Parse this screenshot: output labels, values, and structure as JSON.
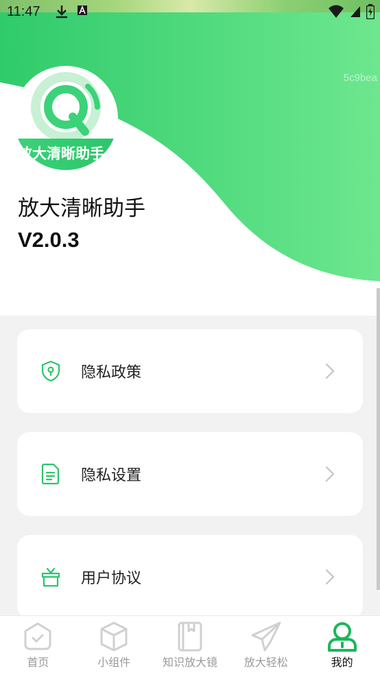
{
  "status_bar": {
    "time": "11:47",
    "left_icons": [
      "download-icon",
      "a-badge-icon"
    ],
    "right_icons": [
      "wifi-icon",
      "signal-icon",
      "battery-icon"
    ]
  },
  "header": {
    "watermark": "5c9bea",
    "logo_text": "放大清晰助手",
    "app_name": "放大清晰助手",
    "version": "V2.0.3",
    "accent_color": "#3dd37a"
  },
  "menu": [
    {
      "label": "隐私政策",
      "icon": "shield-icon"
    },
    {
      "label": "隐私设置",
      "icon": "document-icon"
    },
    {
      "label": "用户协议",
      "icon": "gift-icon"
    }
  ],
  "bottom_nav": [
    {
      "label": "首页",
      "icon": "home-icon",
      "active": false
    },
    {
      "label": "小组件",
      "icon": "cube-icon",
      "active": false
    },
    {
      "label": "知识放大镜",
      "icon": "book-icon",
      "active": false
    },
    {
      "label": "放大轻松",
      "icon": "paper-plane-icon",
      "active": false
    },
    {
      "label": "我的",
      "icon": "user-icon",
      "active": true
    }
  ]
}
